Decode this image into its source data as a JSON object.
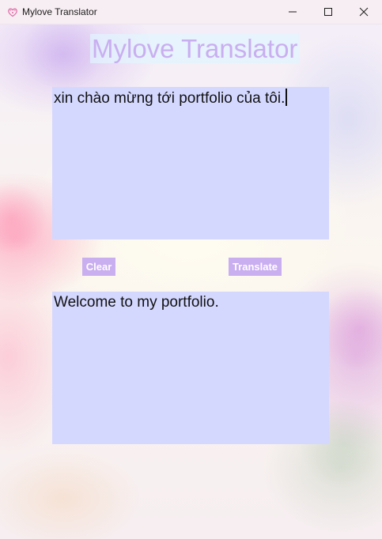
{
  "window": {
    "title": "Mylove Translator",
    "icon": "heart-flower-icon"
  },
  "controls": {
    "minimize_icon": "minimize-icon",
    "maximize_icon": "maximize-icon",
    "close_icon": "close-icon"
  },
  "main": {
    "heading": "Mylove Translator",
    "source_text": "xin chào mừng tới portfolio của tôi.",
    "clear_label": "Clear",
    "translate_label": "Translate",
    "output_text": "Welcome to my portfolio."
  },
  "colors": {
    "heading_text": "#c9aef0",
    "button_bg": "#c9aef0",
    "textbox_bg": "#d4d8ff"
  }
}
